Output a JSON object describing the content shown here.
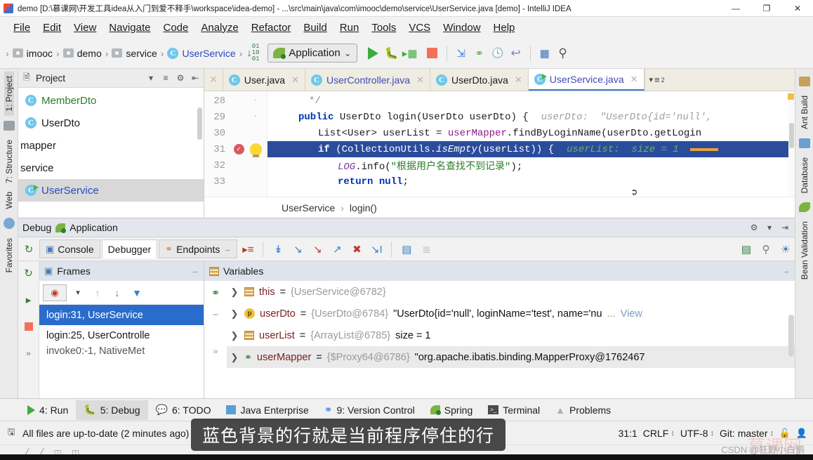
{
  "window": {
    "title": "demo [D:\\慕课网\\开发工具idea从入门到爱不释手\\workspace\\idea-demo] - ...\\src\\main\\java\\com\\imooc\\demo\\service\\UserService.java [demo] - IntelliJ IDEA",
    "app_icon": "intellij-idea-icon",
    "minimize": "—",
    "maximize": "❐",
    "close": "✕"
  },
  "menubar": {
    "items": [
      {
        "label": "File",
        "mnemonic": "F"
      },
      {
        "label": "Edit",
        "mnemonic": "E"
      },
      {
        "label": "View",
        "mnemonic": "V"
      },
      {
        "label": "Navigate",
        "mnemonic": "N"
      },
      {
        "label": "Code",
        "mnemonic": "C"
      },
      {
        "label": "Analyze",
        "mnemonic": "A"
      },
      {
        "label": "Refactor",
        "mnemonic": "R"
      },
      {
        "label": "Build",
        "mnemonic": "B"
      },
      {
        "label": "Run",
        "mnemonic": "R"
      },
      {
        "label": "Tools",
        "mnemonic": "T"
      },
      {
        "label": "VCS",
        "mnemonic": "V"
      },
      {
        "label": "Window",
        "mnemonic": "W"
      },
      {
        "label": "Help",
        "mnemonic": "H"
      }
    ]
  },
  "navbar": {
    "breadcrumbs": [
      {
        "label": "imooc",
        "icon": "folder-icon"
      },
      {
        "label": "demo",
        "icon": "folder-icon"
      },
      {
        "label": "service",
        "icon": "folder-icon"
      },
      {
        "label": "UserService",
        "icon": "java-class-icon",
        "highlight": true
      }
    ],
    "separator": "›",
    "run_config": {
      "label": "Application",
      "icon": "spring-boot-icon",
      "chevron": "⌄"
    },
    "buttons": [
      {
        "name": "run-button",
        "icon": "play-icon"
      },
      {
        "name": "debug-button",
        "icon": "bug-icon"
      },
      {
        "name": "run-coverage-button",
        "icon": "coverage-icon"
      },
      {
        "name": "stop-button",
        "icon": "stop-icon"
      },
      {
        "name": "update-project-button",
        "icon": "vcs-update-icon"
      },
      {
        "name": "commit-button",
        "icon": "vcs-commit-icon"
      },
      {
        "name": "history-button",
        "icon": "vcs-history-icon"
      },
      {
        "name": "rollback-button",
        "icon": "vcs-rollback-icon"
      },
      {
        "name": "database-button",
        "icon": "database-icon"
      },
      {
        "name": "search-everywhere-button",
        "icon": "search-icon"
      }
    ]
  },
  "left_rail": {
    "items": [
      {
        "label": "1: Project",
        "selected": true
      },
      {
        "label": "7: Structure",
        "selected": false
      },
      {
        "label": "Web",
        "selected": false
      },
      {
        "label": "Favorites",
        "selected": false
      }
    ]
  },
  "right_rail": {
    "items": [
      {
        "label": "Ant Build"
      },
      {
        "label": "Database"
      },
      {
        "label": "Bean Validation"
      }
    ]
  },
  "project_panel": {
    "title": "Project",
    "icons": [
      "project-view-icon",
      "chevron-down-icon",
      "collapse-all-icon",
      "settings-gear-icon",
      "hide-panel-icon"
    ],
    "tree": [
      {
        "label": "MemberDto",
        "icon": "java-class-icon",
        "color": "green",
        "selected": false
      },
      {
        "label": "UserDto",
        "icon": "java-class-icon",
        "color": "normal",
        "selected": false
      },
      {
        "label": "mapper",
        "icon": "package-icon",
        "color": "normal",
        "selected": false
      },
      {
        "label": "service",
        "icon": "package-icon",
        "color": "normal",
        "selected": false
      },
      {
        "label": "UserService",
        "icon": "java-class-runnable-icon",
        "color": "blue",
        "selected": true
      }
    ]
  },
  "editor": {
    "tabs": [
      {
        "label": "User.java",
        "icon": "java-class-icon",
        "active": false,
        "blue": false
      },
      {
        "label": "UserController.java",
        "icon": "java-class-icon",
        "active": false,
        "blue": true
      },
      {
        "label": "UserDto.java",
        "icon": "java-class-icon",
        "active": false,
        "blue": false
      },
      {
        "label": "UserService.java",
        "icon": "java-class-runnable-icon",
        "active": true,
        "blue": true
      }
    ],
    "close_glyph": "✕",
    "code_lines": [
      {
        "num": "28",
        "marker": "",
        "fold": "◦",
        "text": "*/"
      },
      {
        "num": "29",
        "marker": "",
        "fold": "◦",
        "text": "public UserDto login(UserDto userDto) {",
        "hint": "userDto:  \"UserDto{id='null',"
      },
      {
        "num": "30",
        "marker": "",
        "fold": "",
        "text": "List<User> userList = userMapper.findByLoginName(userDto.getLogin"
      },
      {
        "num": "31",
        "marker": "breakpoint-icon",
        "fold": "bulb-icon",
        "text": "if (CollectionUtils.isEmpty(userList)) {",
        "hint": "userList:  size = 1",
        "highlighted": true
      },
      {
        "num": "32",
        "marker": "",
        "fold": "",
        "text": "LOG.info(\"根据用户名查找不到记录\");"
      },
      {
        "num": "33",
        "marker": "",
        "fold": "",
        "text": "return null;"
      }
    ],
    "breadcrumb": [
      "UserService",
      "login()"
    ],
    "breadcrumb_sep": "›"
  },
  "debug": {
    "header_title": "Debug",
    "header_config": "Application",
    "header_icons": [
      "settings-gear-icon",
      "hide-panel-icon"
    ],
    "tabs": [
      {
        "label": "Console",
        "icon": "console-icon",
        "active": false
      },
      {
        "label": "Debugger",
        "icon": "",
        "active": true
      },
      {
        "label": "Endpoints",
        "icon": "endpoints-icon",
        "active": false
      }
    ],
    "toolbar_icons": [
      "show-execution-point-icon",
      "step-over-icon",
      "step-into-icon",
      "force-step-into-icon",
      "step-out-icon",
      "drop-frame-icon",
      "run-to-cursor-icon",
      "evaluate-expression-icon",
      "layout-icon",
      "mute-breakpoints-icon",
      "view-breakpoints-icon",
      "settings-icon"
    ],
    "left_rail_icons": [
      "rerun-icon",
      "resume-icon",
      "stop-icon",
      "expand-icon"
    ],
    "frames": {
      "title": "Frames",
      "thread_selector": "debug-thread-selector",
      "toolbar_icons": [
        "thread-icon",
        "chevron-down-icon",
        "up-icon",
        "down-icon",
        "filter-icon"
      ],
      "rows": [
        {
          "label": "login:31, UserService",
          "selected": true
        },
        {
          "label": "login:25, UserControlle",
          "selected": false
        },
        {
          "label": "invoke0:-1, NativeMet",
          "selected": false
        }
      ]
    },
    "variables": {
      "title": "Variables",
      "rail_icons": [
        "new-watch-icon",
        "remove-watch-icon",
        "more-icon"
      ],
      "expander": "❯",
      "rows": [
        {
          "icon": "object-icon",
          "name": "this",
          "eq": "=",
          "ref": "{UserService@6782}",
          "value": ""
        },
        {
          "icon": "parameter-icon",
          "name": "userDto",
          "eq": "=",
          "ref": "{UserDto@6784}",
          "value": "\"UserDto{id='null', loginName='test', name='nu",
          "ellipsis": "...",
          "link": "View"
        },
        {
          "icon": "object-icon",
          "name": "userList",
          "eq": "=",
          "ref": "{ArrayList@6785}",
          "value": "size = 1"
        },
        {
          "icon": "field-icon",
          "name": "userMapper",
          "eq": "=",
          "ref": "{$Proxy64@6786}",
          "value": "\"org.apache.ibatis.binding.MapperProxy@1762467",
          "selected": true
        }
      ]
    }
  },
  "toolwindow_bar": {
    "items": [
      {
        "label": "4: Run",
        "mnemonic": "4",
        "icon": "play-icon",
        "selected": false
      },
      {
        "label": "5: Debug",
        "mnemonic": "5",
        "icon": "bug-icon",
        "selected": true
      },
      {
        "label": "6: TODO",
        "mnemonic": "6",
        "icon": "todo-icon",
        "selected": false
      },
      {
        "label": "Java Enterprise",
        "mnemonic": "",
        "icon": "java-enterprise-icon",
        "selected": false
      },
      {
        "label": "9: Version Control",
        "mnemonic": "9",
        "icon": "vcs-icon",
        "selected": false
      },
      {
        "label": "Spring",
        "mnemonic": "",
        "icon": "spring-leaf-icon",
        "selected": false
      },
      {
        "label": "Terminal",
        "mnemonic": "",
        "icon": "terminal-icon",
        "selected": false
      },
      {
        "label": "Problems",
        "mnemonic": "",
        "icon": "warning-icon",
        "selected": false
      }
    ]
  },
  "statusbar": {
    "message": "All files are up-to-date (2 minutes ago)",
    "message_icon": "save-icon",
    "caret_position": "31:1",
    "line_separator": "CRLF",
    "encoding": "UTF-8",
    "branch": "Git: master",
    "lock_icon": "unlocked-icon",
    "inspector_icon": "inspector-icon",
    "spinner": "↕"
  },
  "overlay": {
    "subtitle": "蓝色背景的行就是当前程序停住的行",
    "csdn": "CSDN @狂野小白鹅",
    "watermark": "慕课网"
  }
}
